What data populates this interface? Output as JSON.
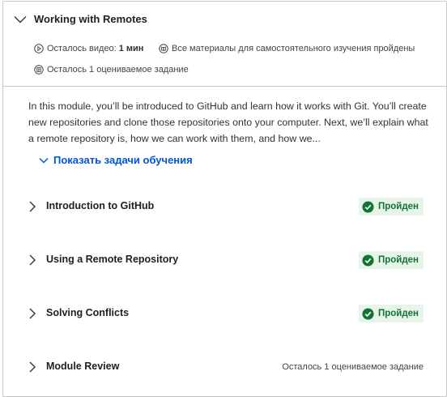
{
  "module": {
    "title": "Working with Remotes",
    "meta": {
      "videos_label": "Осталось видео:",
      "videos_value": "1 мин",
      "self_study_label": "Все материалы для самостоятельного изучения пройдены",
      "graded_label": "Осталось 1 оцениваемое задание"
    },
    "description": "In this module, you’ll be introduced to GitHub and learn how it works with Git. You’ll create new repositories and clone those repositories onto your computer. Next, we’ll explain what a remote repository is, how we can work with them, and how we...",
    "show_objectives_label": "Показать задачи обучения"
  },
  "lessons": [
    {
      "title": "Introduction to GitHub",
      "status": "Пройден"
    },
    {
      "title": "Using a Remote Repository",
      "status": "Пройден"
    },
    {
      "title": "Solving Conflicts",
      "status": "Пройден"
    },
    {
      "title": "Module Review",
      "remaining": "Осталось 1 оцениваемое задание"
    }
  ],
  "colors": {
    "accent": "#0056d2",
    "success": "#137333",
    "success_bg": "#e6f4ea",
    "border": "#c8c8c8"
  },
  "icons": {
    "module_toggle": "chevron-down-icon",
    "lesson_toggle": "chevron-right-icon",
    "video": "play-circle-icon",
    "reading": "book-icon",
    "graded": "assignment-icon",
    "completed": "check-circle-icon"
  }
}
